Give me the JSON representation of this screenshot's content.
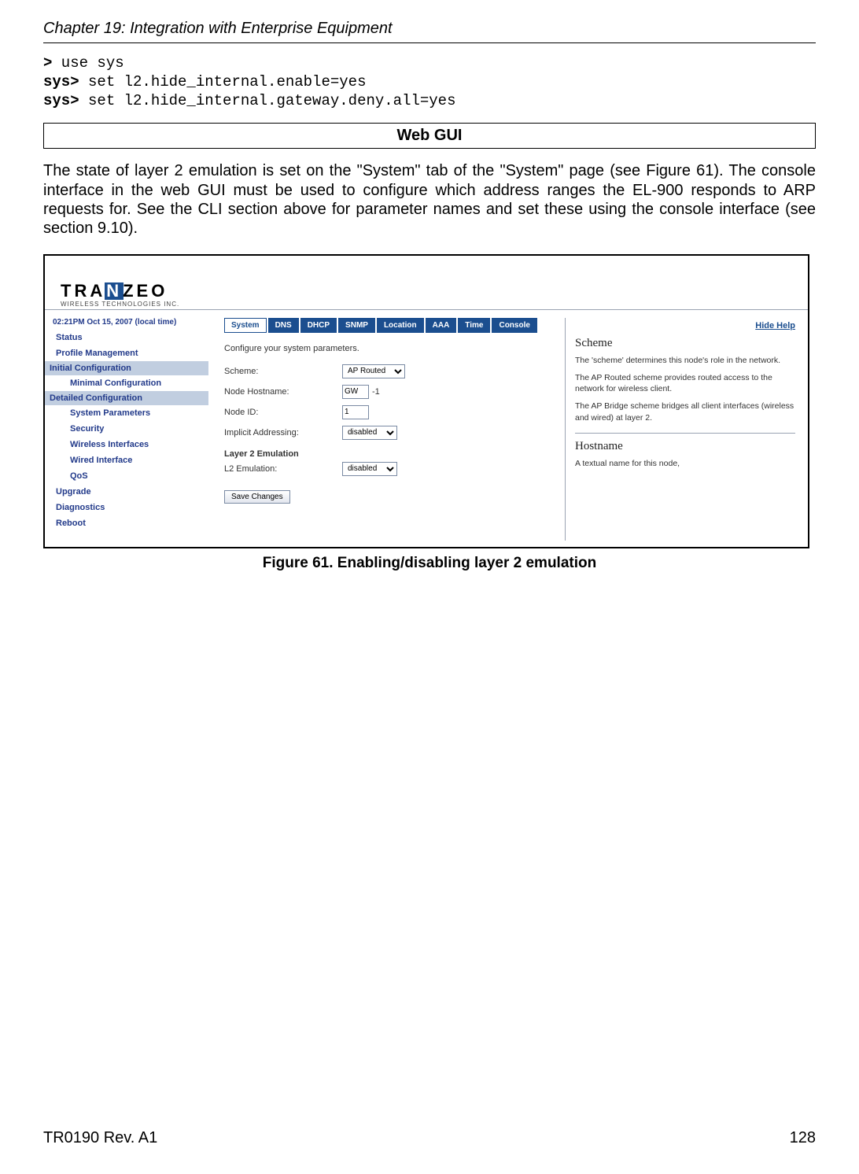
{
  "header": {
    "chapter_title": "Chapter 19: Integration with Enterprise Equipment"
  },
  "cli": {
    "p1a": ">",
    "p1b": " use sys",
    "p2a": "sys>",
    "p2b": " set l2.hide_internal.enable=yes",
    "p3a": "sys>",
    "p3b": " set l2.hide_internal.gateway.deny.all=yes"
  },
  "section_title": "Web GUI",
  "body_paragraph": "The state of layer 2 emulation is set on the \"System\" tab of the \"System\" page (see Figure 61). The console interface in the web GUI must be used to configure which address ranges the EL-900 responds to ARP requests for. See the CLI section above for parameter names and set these using the console interface (see section 9.10).",
  "figure": {
    "logo_main": "TRA",
    "logo_z": "N",
    "logo_end": "ZEO",
    "logo_sub": "WIRELESS  TECHNOLOGIES INC.",
    "sidebar": {
      "time": "02:21PM Oct 15, 2007 (local time)",
      "items_top": [
        "Status",
        "Profile Management"
      ],
      "group1": "Initial Configuration",
      "group1_subs": [
        "Minimal Configuration"
      ],
      "group2": "Detailed Configuration",
      "group2_subs": [
        "System Parameters",
        "Security",
        "Wireless Interfaces",
        "Wired Interface",
        "QoS"
      ],
      "items_bottom": [
        "Upgrade",
        "Diagnostics",
        "Reboot"
      ]
    },
    "tabs": [
      "System",
      "DNS",
      "DHCP",
      "SNMP",
      "Location",
      "AAA",
      "Time",
      "Console"
    ],
    "form": {
      "desc": "Configure your system parameters.",
      "scheme_label": "Scheme:",
      "scheme_value": "AP Routed",
      "host_label": "Node Hostname:",
      "host_value": "GW",
      "host_suffix": "-1",
      "id_label": "Node ID:",
      "id_value": "1",
      "impl_label": "Implicit Addressing:",
      "impl_value": "disabled",
      "l2_title": "Layer 2 Emulation",
      "l2_label": "L2 Emulation:",
      "l2_value": "disabled",
      "save": "Save Changes"
    },
    "help": {
      "hide": "Hide Help",
      "h1": "Scheme",
      "p1": "The 'scheme' determines this node's role in the network.",
      "p2": "The AP Routed scheme provides routed access to the network for wireless client.",
      "p3": "The AP Bridge scheme bridges all client interfaces (wireless and wired) at layer 2.",
      "h2": "Hostname",
      "p4": "A textual name for this node,"
    }
  },
  "figure_caption": "Figure 61. Enabling/disabling layer 2 emulation",
  "footer": {
    "left": "TR0190 Rev. A1",
    "right": "128"
  }
}
